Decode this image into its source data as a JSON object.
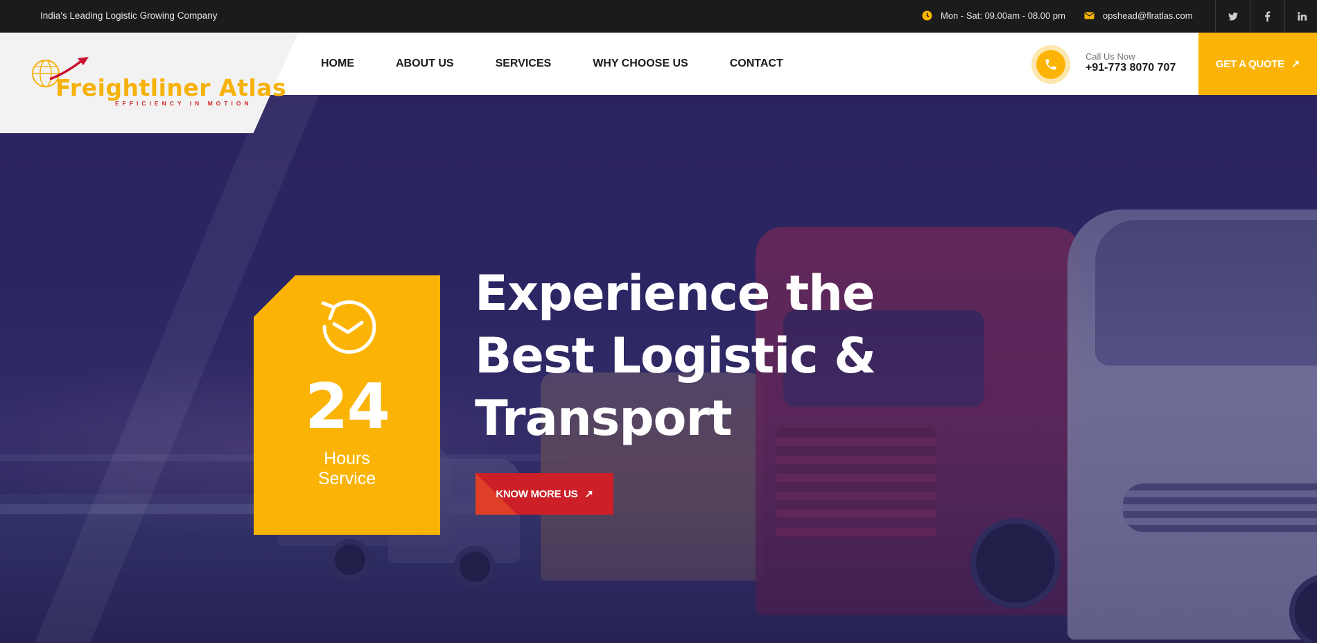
{
  "topbar": {
    "tagline": "India's Leading Logistic Growing Company",
    "hours": "Mon - Sat: 09.00am - 08.00 pm",
    "email": "opshead@flratlas.com",
    "social": [
      "twitter-icon",
      "facebook-icon",
      "linkedin-icon"
    ],
    "social_glyphs": [
      "𝕥",
      "f",
      "in"
    ]
  },
  "logo": {
    "name": "Freightliner Atlas",
    "tagline": "EFFICIENCY IN MOTION"
  },
  "nav": {
    "items": [
      "HOME",
      "ABOUT US",
      "SERVICES",
      "WHY CHOOSE US",
      "CONTACT"
    ]
  },
  "call": {
    "label": "Call Us Now",
    "number": "+91-773 8070 707"
  },
  "cta": {
    "quote_label": "GET A QUOTE",
    "arrow": "↗"
  },
  "hero": {
    "badge_number": "24",
    "badge_line1": "Hours",
    "badge_line2": "Service",
    "headline_line1": "Experience the",
    "headline_line2": "Best Logistic &",
    "headline_line3": "Transport",
    "button_label": "KNOW MORE US",
    "button_arrow": "↗"
  },
  "colors": {
    "accent": "#fbb405",
    "red": "#cd1f27",
    "dark": "#1b1b1b",
    "hero_tint": "#2d2660"
  }
}
